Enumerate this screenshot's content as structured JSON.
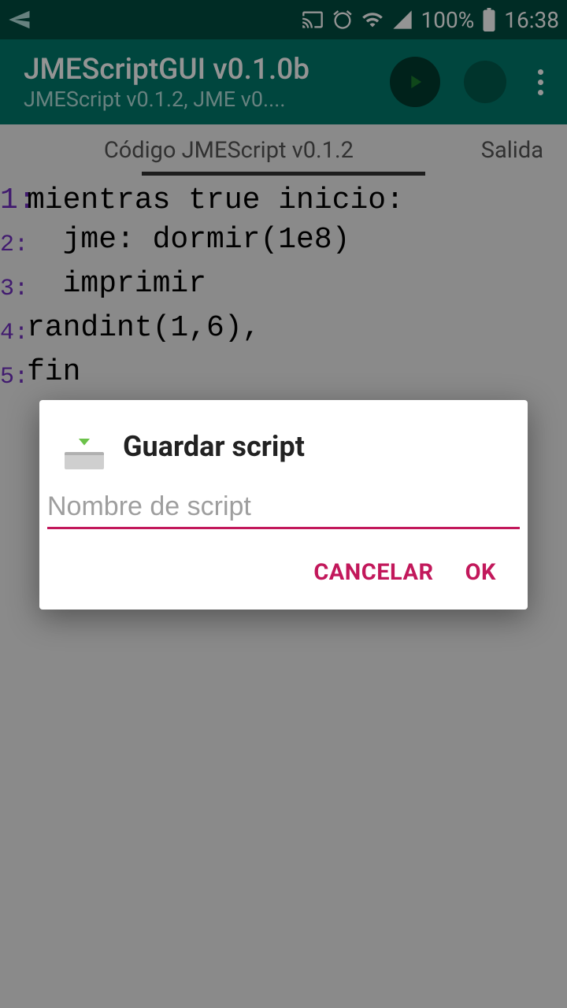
{
  "status": {
    "battery_text": "100%",
    "time": "16:38"
  },
  "appbar": {
    "title": "JMEScriptGUI v0.1.0b",
    "subtitle": "JMEScript v0.1.2, JME v0...."
  },
  "tabs": {
    "main": "Código JMEScript v0.1.2",
    "right": "Salida"
  },
  "code": {
    "lines": [
      {
        "num": "1:",
        "text": "mientras true inicio:"
      },
      {
        "num": "2:",
        "text": "  jme: dormir(1e8)"
      },
      {
        "num": "3:",
        "text": "  imprimir"
      },
      {
        "num": "4:",
        "text": "randint(1,6),"
      },
      {
        "num": "5:",
        "text": "fin"
      }
    ]
  },
  "dialog": {
    "title": "Guardar script",
    "placeholder": "Nombre de script",
    "cancel": "CANCELAR",
    "ok": "OK"
  },
  "colors": {
    "accent": "#c2185b",
    "primary": "#00796b"
  }
}
